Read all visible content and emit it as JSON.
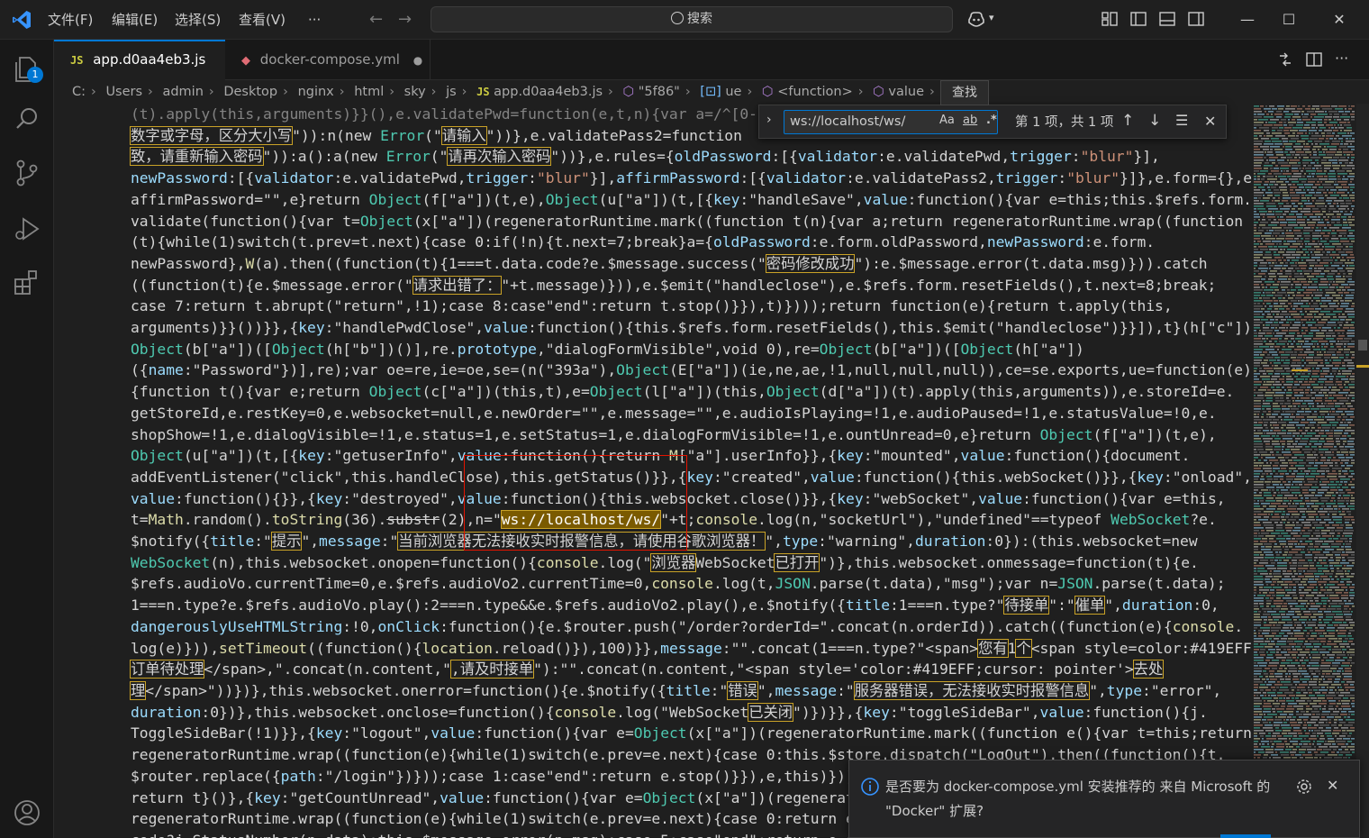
{
  "menu": {
    "file": "文件(F)",
    "edit": "编辑(E)",
    "selection": "选择(S)",
    "view": "查看(V)",
    "more": "···"
  },
  "search": {
    "label": "搜索"
  },
  "window": {
    "minimize": "—",
    "maximize": "☐",
    "close": "✕"
  },
  "tabs": [
    {
      "badge": "JS",
      "label": "app.d0aa4eb3.js",
      "close": "✕",
      "active": true
    },
    {
      "label": "docker-compose.yml",
      "close": "●",
      "active": false
    }
  ],
  "breadcrumb": [
    {
      "label": "C:"
    },
    {
      "label": "Users"
    },
    {
      "label": "admin"
    },
    {
      "label": "Desktop"
    },
    {
      "label": "nginx"
    },
    {
      "label": "html"
    },
    {
      "label": "sky"
    },
    {
      "label": "js"
    },
    {
      "badge": "JS",
      "label": "app.d0aa4eb3.js"
    },
    {
      "label": "\"5f86\""
    },
    {
      "label": "ue"
    },
    {
      "label": "<function>"
    },
    {
      "label": "value"
    }
  ],
  "activity_badge": "1",
  "find": {
    "value": "ws://localhost/ws/",
    "match_case": "Aa",
    "whole_word": "ab",
    "regex": ".*",
    "count": "第 1 项，共 1 项",
    "tooltip": "查找"
  },
  "notification": {
    "text": "是否要为 docker-compose.yml 安装推荐的 来自 Microsoft 的 \"Docker\" 扩展?"
  },
  "colors": {
    "accent": "#0078d4",
    "editor_bg": "#1f1f1f",
    "match_bg": "#7a5a00",
    "highlight_border": "#e51400"
  }
}
